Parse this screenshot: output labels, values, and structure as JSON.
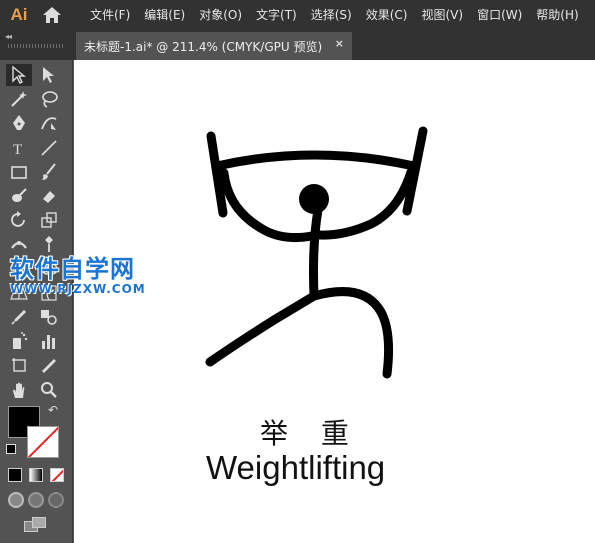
{
  "app": {
    "logo": "Ai"
  },
  "menu": [
    "文件(F)",
    "编辑(E)",
    "对象(O)",
    "文字(T)",
    "选择(S)",
    "效果(C)",
    "视图(V)",
    "窗口(W)",
    "帮助(H)"
  ],
  "document_tab": {
    "title": "未标题-1.ai* @ 211.4% (CMYK/GPU 预览)",
    "close": "×"
  },
  "panel": {
    "collapse": "◂◂"
  },
  "tools": [
    "selection-tool",
    "direct-selection-tool",
    "magic-wand-tool",
    "lasso-tool",
    "pen-tool",
    "curvature-tool",
    "type-tool",
    "line-segment-tool",
    "rectangle-tool",
    "paintbrush-tool",
    "blob-brush-tool",
    "eraser-tool",
    "rotate-tool",
    "scale-tool",
    "width-tool",
    "puppet-warp-tool",
    "free-transform-tool",
    "shape-builder-tool",
    "perspective-grid-tool",
    "mesh-tool",
    "eyedropper-tool",
    "blend-tool",
    "symbol-sprayer-tool",
    "column-graph-tool",
    "artboard-tool",
    "slice-tool",
    "hand-tool",
    "zoom-tool"
  ],
  "canvas": {
    "caption_cn": "举 重",
    "caption_en": "Weightlifting"
  },
  "watermark": {
    "title": "软件自学网",
    "url": "WWW.RJZXW.COM"
  },
  "colors": {
    "menubar": "#323232",
    "panel": "#535353",
    "canvas": "#ffffff",
    "accent": "#e8a049",
    "watermark": "#1a74d6"
  }
}
